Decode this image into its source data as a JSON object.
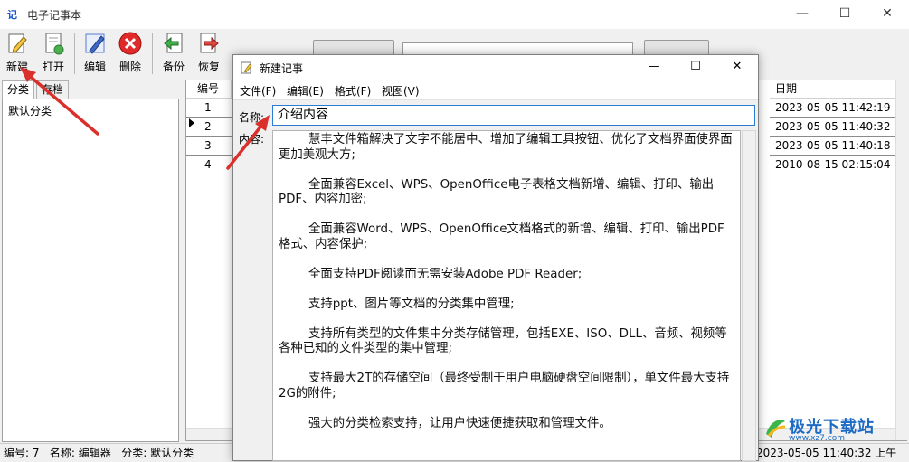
{
  "window": {
    "title": "电子记事本",
    "app_icon_text": "记",
    "minimize": "—",
    "maximize": "☐",
    "close": "✕"
  },
  "toolbar": {
    "new_label": "新建",
    "open_label": "打开",
    "edit_label": "编辑",
    "delete_label": "删除",
    "backup_label": "备份",
    "restore_label": "恢复"
  },
  "left_panel": {
    "tabs": [
      "分类",
      "存档"
    ],
    "categories": [
      "默认分类"
    ]
  },
  "list": {
    "header_num": "编号",
    "header_date": "日期",
    "rows": [
      {
        "num": "1",
        "date": "2023-05-05 11:42:19"
      },
      {
        "num": "2",
        "date": "2023-05-05 11:40:32"
      },
      {
        "num": "3",
        "date": "2023-05-05 11:40:18"
      },
      {
        "num": "4",
        "date": "2010-08-15 02:15:04"
      }
    ]
  },
  "status": {
    "left": "编号: 7   名称: 编辑器   分类: 默认分类",
    "right": "2023-05-05 11:40:32 上午"
  },
  "dialog": {
    "title": "新建记事",
    "menu": [
      "文件(F)",
      "编辑(E)",
      "格式(F)",
      "视图(V)"
    ],
    "name_label": "名称:",
    "name_value": "介绍内容",
    "content_label": "内容:",
    "content": [
      "慧丰文件箱解决了文字不能居中、增加了编辑工具按钮、优化了文档界面使界面更加美观大方;",
      "全面兼容Excel、WPS、OpenOffice电子表格文档新增、编辑、打印、输出PDF、内容加密;",
      "全面兼容Word、WPS、OpenOffice文档格式的新增、编辑、打印、输出PDF格式、内容保护;",
      "全面支持PDF阅读而无需安装Adobe PDF Reader;",
      "支持ppt、图片等文档的分类集中管理;",
      "支持所有类型的文件集中分类存储管理，包括EXE、ISO、DLL、音频、视频等各种已知的文件类型的集中管理;",
      "支持最大2T的存储空间（最终受制于用户电脑硬盘空间限制），单文件最大支持2G的附件;",
      "强大的分类检索支持，让用户快速便捷获取和管理文件。"
    ]
  },
  "watermark": {
    "text": "极光下载站",
    "url": "www.xz7.com"
  },
  "colors": {
    "arrow": "#d9302b",
    "accent": "#2b7bd4"
  }
}
